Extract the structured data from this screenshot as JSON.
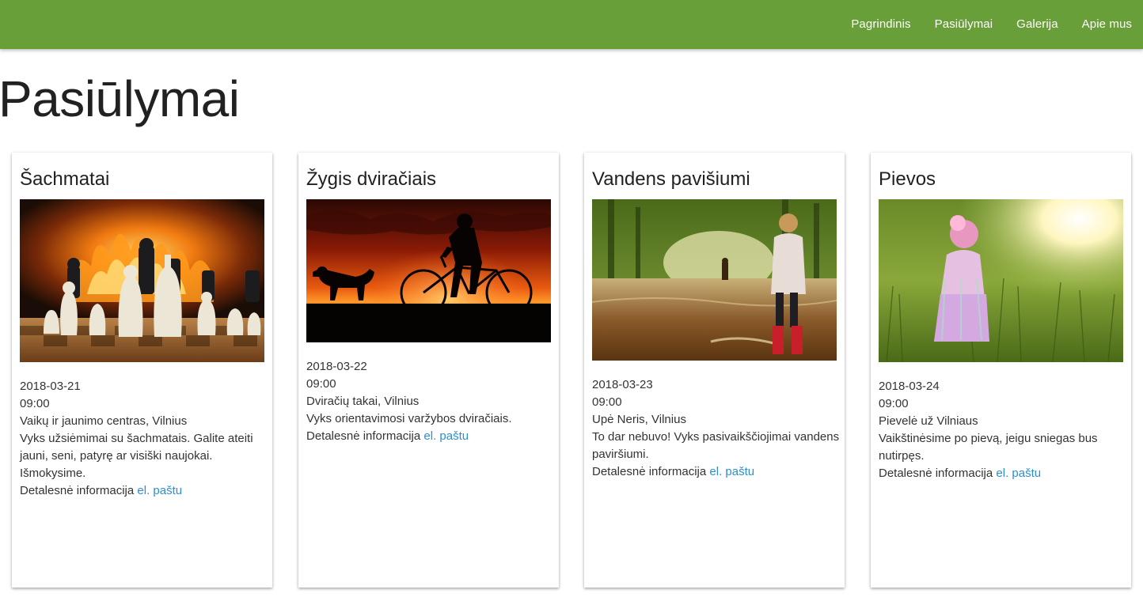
{
  "nav": {
    "items": [
      {
        "label": "Pagrindinis"
      },
      {
        "label": "Pasiūlymai"
      },
      {
        "label": "Galerija"
      },
      {
        "label": "Apie mus"
      }
    ]
  },
  "page": {
    "title": "Pasiūlymai"
  },
  "cards": [
    {
      "title": "Šachmatai",
      "image": "chess-pieces-fireplace-photo",
      "date": "2018-03-21",
      "time": "09:00",
      "location": "Vaikų ir jaunimo centras, Vilnius",
      "description": "Vyks užsiėmimai su šachmatais. Galite ateiti jauni, seni, patyrę ar visiški naujokai. Išmokysime.",
      "details_prefix": "Detalesnė informacija",
      "details_link": "el. paštu"
    },
    {
      "title": "Žygis dviračiais",
      "image": "bicycle-sunset-silhouette-photo",
      "date": "2018-03-22",
      "time": "09:00",
      "location": "Dviračių takai, Vilnius",
      "description": "Vyks orientavimosi varžybos dviračiais.",
      "details_prefix": "Detalesnė informacija",
      "details_link": "el. paštu"
    },
    {
      "title": "Vandens pavišiumi",
      "image": "girl-flooded-road-photo",
      "date": "2018-03-23",
      "time": "09:00",
      "location": "Upė Neris, Vilnius",
      "description": "To dar nebuvo! Vyks pasivaikščiojimai vandens paviršiumi.",
      "details_prefix": "Detalesnė informacija",
      "details_link": "el. paštu"
    },
    {
      "title": "Pievos",
      "image": "girl-meadow-photo",
      "date": "2018-03-24",
      "time": "09:00",
      "location": "Pievelė už Vilniaus",
      "description": "Vaikštinėsime po pievą, jeigu sniegas bus nutirpęs.",
      "details_prefix": "Detalesnė informacija",
      "details_link": "el. paštu"
    }
  ],
  "colors": {
    "navbar": "#689f38",
    "link": "#2b8fd0"
  }
}
